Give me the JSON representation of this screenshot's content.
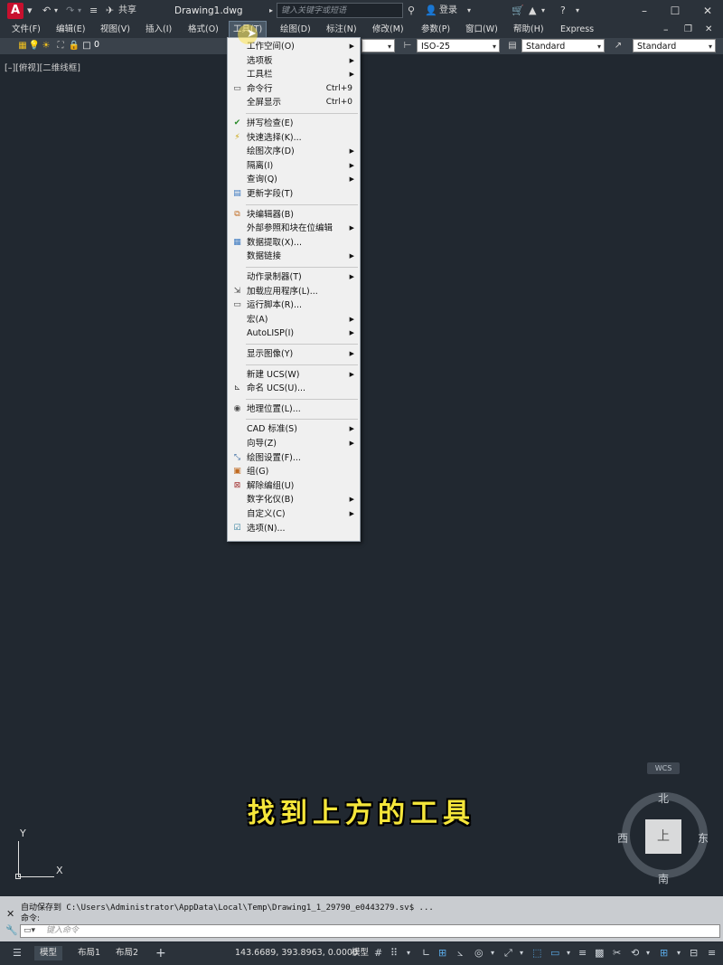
{
  "titlebar": {
    "logo": "A",
    "share": "共享",
    "doc_title": "Drawing1.dwg",
    "search_placeholder": "键入关键字或短语",
    "login": "登录"
  },
  "menubar": [
    "文件(F)",
    "编辑(E)",
    "视图(V)",
    "插入(I)",
    "格式(O)",
    "工具(T)",
    "绘图(D)",
    "标注(N)",
    "修改(M)",
    "参数(P)",
    "窗口(W)",
    "帮助(H)",
    "Express"
  ],
  "toolbar": {
    "layer": "0",
    "dimstyle": "ISO-25",
    "tablestyle": "Standard",
    "mleaderstyle": "Standard"
  },
  "viewport_label": "[–][俯视][二维线框]",
  "tools_menu": [
    {
      "label": "工作空间(O)",
      "arrow": true
    },
    {
      "label": "选项板",
      "arrow": true
    },
    {
      "label": "工具栏",
      "arrow": true
    },
    {
      "label": "命令行",
      "shortcut": "Ctrl+9",
      "icon": "command-line-icon"
    },
    {
      "label": "全屏显示",
      "shortcut": "Ctrl+0"
    },
    {
      "sep": true
    },
    {
      "label": "拼写检查(E)",
      "icon": "spellcheck-icon"
    },
    {
      "label": "快速选择(K)...",
      "icon": "quick-select-icon"
    },
    {
      "label": "绘图次序(D)",
      "arrow": true
    },
    {
      "label": "隔离(I)",
      "arrow": true
    },
    {
      "label": "查询(Q)",
      "arrow": true
    },
    {
      "label": "更新字段(T)",
      "icon": "update-field-icon"
    },
    {
      "sep": true
    },
    {
      "label": "块编辑器(B)",
      "icon": "block-editor-icon"
    },
    {
      "label": "外部参照和块在位编辑",
      "arrow": true
    },
    {
      "label": "数据提取(X)...",
      "icon": "data-extract-icon"
    },
    {
      "label": "数据链接",
      "arrow": true
    },
    {
      "sep": true
    },
    {
      "label": "动作录制器(T)",
      "arrow": true
    },
    {
      "label": "加载应用程序(L)...",
      "icon": "load-app-icon"
    },
    {
      "label": "运行脚本(R)...",
      "icon": "run-script-icon"
    },
    {
      "label": "宏(A)",
      "arrow": true
    },
    {
      "label": "AutoLISP(I)",
      "arrow": true
    },
    {
      "sep": true
    },
    {
      "label": "显示图像(Y)",
      "arrow": true
    },
    {
      "sep": true
    },
    {
      "label": "新建 UCS(W)",
      "arrow": true
    },
    {
      "label": "命名 UCS(U)...",
      "icon": "named-ucs-icon"
    },
    {
      "sep": true
    },
    {
      "label": "地理位置(L)...",
      "icon": "geolocation-icon"
    },
    {
      "sep": true
    },
    {
      "label": "CAD 标准(S)",
      "arrow": true
    },
    {
      "label": "向导(Z)",
      "arrow": true
    },
    {
      "label": "绘图设置(F)...",
      "icon": "drafting-settings-icon"
    },
    {
      "label": "组(G)",
      "icon": "group-icon"
    },
    {
      "label": "解除编组(U)",
      "icon": "ungroup-icon"
    },
    {
      "label": "数字化仪(B)",
      "arrow": true
    },
    {
      "label": "自定义(C)",
      "arrow": true
    },
    {
      "label": "选项(N)...",
      "icon": "options-check-icon"
    }
  ],
  "subtitle": "找到上方的工具",
  "viewcube": {
    "wcs": "WCS",
    "north": "北",
    "south": "南",
    "east": "东",
    "west": "西",
    "face": "上"
  },
  "ucs": {
    "x": "X",
    "y": "Y"
  },
  "command": {
    "line1": "自动保存到 C:\\Users\\Administrator\\AppData\\Local\\Temp\\Drawing1_1_29790_e0443279.sv$ ...",
    "line2": "命令:",
    "placeholder": "键入命令"
  },
  "status": {
    "tab_model": "模型",
    "tab_layout1": "布局1",
    "tab_layout2": "布局2",
    "add": "+",
    "coords": "143.6689, 393.8963, 0.0000",
    "model_button": "模型"
  }
}
